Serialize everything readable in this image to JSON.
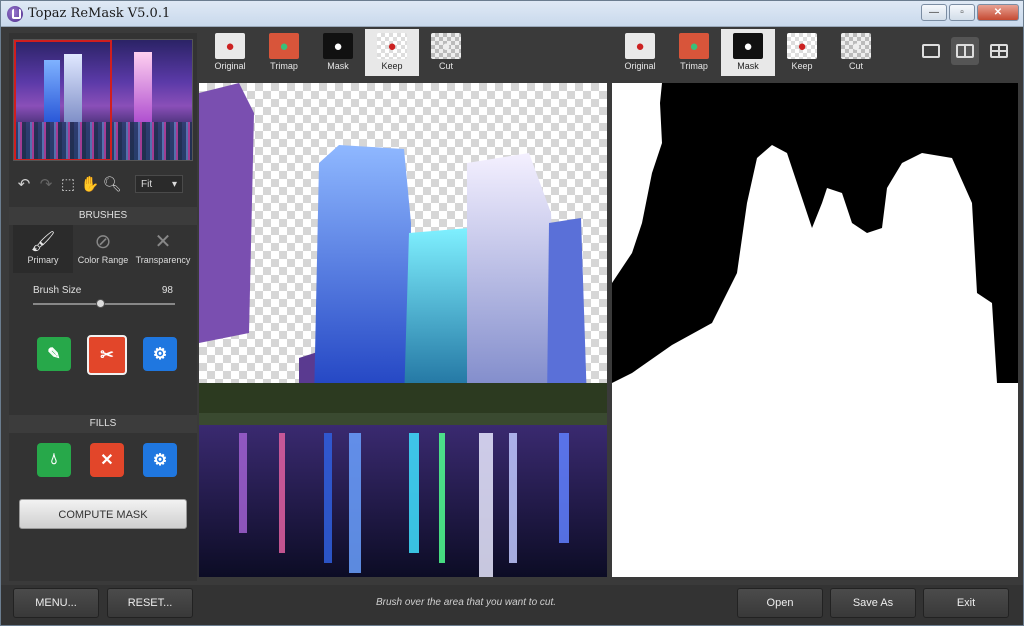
{
  "window": {
    "title": "Topaz ReMask V5.0.1",
    "minimize": "—",
    "maximize": "▫",
    "close": "✕"
  },
  "left_panel": {
    "zoom_value": "Fit",
    "brushes_title": "BRUSHES",
    "brush_tabs": [
      {
        "label": "Primary",
        "icon": "brush-icon"
      },
      {
        "label": "Color Range",
        "icon": "color-range-brush-icon"
      },
      {
        "label": "Transparency",
        "icon": "transparency-brush-icon"
      }
    ],
    "brush_size_label": "Brush Size",
    "brush_size_value": "98",
    "brush_size_fraction": 0.47,
    "fills_title": "FILLS",
    "compute_label": "COMPUTE MASK"
  },
  "left_view_tabs": [
    {
      "label": "Original",
      "icon": "apple-icon"
    },
    {
      "label": "Trimap",
      "icon": "trimap-icon"
    },
    {
      "label": "Mask",
      "icon": "mask-icon"
    },
    {
      "label": "Keep",
      "icon": "keep-icon"
    },
    {
      "label": "Cut",
      "icon": "cut-icon"
    }
  ],
  "right_view_tabs": [
    {
      "label": "Original",
      "icon": "apple-icon"
    },
    {
      "label": "Trimap",
      "icon": "trimap-icon"
    },
    {
      "label": "Mask",
      "icon": "mask-icon"
    },
    {
      "label": "Keep",
      "icon": "keep-icon"
    },
    {
      "label": "Cut",
      "icon": "cut-icon"
    }
  ],
  "left_active_tab": "Keep",
  "right_active_tab": "Mask",
  "bottom": {
    "menu": "MENU...",
    "reset": "RESET...",
    "status": "Brush over the area that you want to cut.",
    "open": "Open",
    "save_as": "Save As",
    "exit": "Exit"
  },
  "colors": {
    "keep_brush": "#27a84a",
    "cut_brush": "#e2462a",
    "compute_brush": "#1f77e0",
    "selection": "#d01e1e"
  }
}
